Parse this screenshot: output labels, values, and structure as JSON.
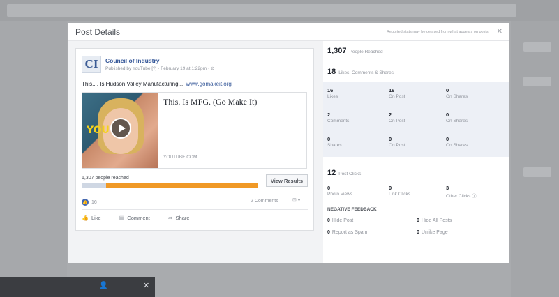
{
  "modal": {
    "title": "Post Details",
    "note": "Reported stats may be delayed from what appears on posts",
    "close_glyph": "✕"
  },
  "post": {
    "page_logo": "CI",
    "author": "Council of Industry",
    "meta": "Published by YouTube [?] · February 19 at 1:22pm · ⊘",
    "text": "This.... Is Hudson Valley Manufacturing....",
    "link_text": "www.gomakeit.org",
    "card": {
      "title": "This. Is MFG. (Go Make It)",
      "domain": "YOUTUBE.COM",
      "thumb_overlay": "YOU"
    },
    "reach_label": "1,307 people reached",
    "reach_fraction": 0.14,
    "view_results": "View Results",
    "likes": "16",
    "comments": "2 Comments",
    "share_select": "⊡ ▾",
    "actions": {
      "like": "Like",
      "comment": "Comment",
      "share": "Share"
    },
    "icons": {
      "like": "thumbs-up-icon",
      "comment": "comment-icon",
      "share": "share-arrow-icon"
    }
  },
  "stats": {
    "reached_num": "1,307",
    "reached_label": "People Reached",
    "engagement_num": "18",
    "engagement_label": "Likes, Comments & Shares",
    "rows": [
      [
        {
          "n": "16",
          "l": "Likes"
        },
        {
          "n": "16",
          "l": "On Post"
        },
        {
          "n": "0",
          "l": "On Shares"
        }
      ],
      [
        {
          "n": "2",
          "l": "Comments"
        },
        {
          "n": "2",
          "l": "On Post"
        },
        {
          "n": "0",
          "l": "On Shares"
        }
      ],
      [
        {
          "n": "0",
          "l": "Shares"
        },
        {
          "n": "0",
          "l": "On Post"
        },
        {
          "n": "0",
          "l": "On Shares"
        }
      ]
    ],
    "clicks_num": "12",
    "clicks_label": "Post Clicks",
    "clicks": [
      {
        "n": "0",
        "l": "Photo Views"
      },
      {
        "n": "9",
        "l": "Link Clicks"
      },
      {
        "n": "3",
        "l": "Other Clicks ⓘ"
      }
    ],
    "negative_title": "NEGATIVE FEEDBACK",
    "negative": [
      {
        "n": "0",
        "l": "Hide Post"
      },
      {
        "n": "0",
        "l": "Hide All Posts"
      },
      {
        "n": "0",
        "l": "Report as Spam"
      },
      {
        "n": "0",
        "l": "Unlike Page"
      }
    ]
  },
  "chat": {
    "person_icon": "👤",
    "close": "✕"
  },
  "colors": {
    "accent": "#365899",
    "reach_bar": "#f09926",
    "panel_blue": "#edf0f6"
  }
}
